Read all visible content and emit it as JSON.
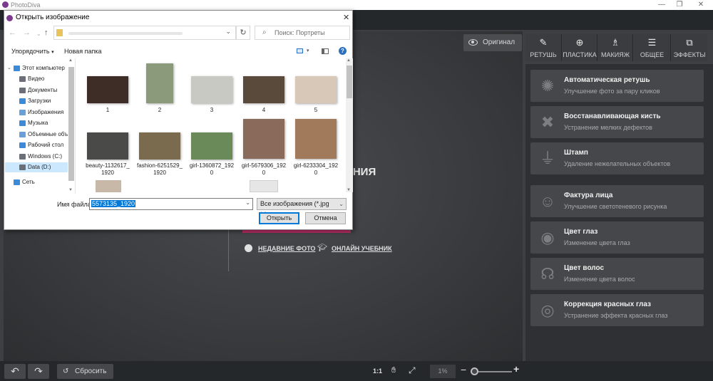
{
  "app": {
    "title": "PhotoDiva",
    "controls": {
      "minimize": "—",
      "restore": "❐",
      "close": "✕"
    }
  },
  "original_button": "Оригинал",
  "toolbar": {
    "tabs": [
      {
        "label": "РЕТУШЬ",
        "icon": "brush-icon"
      },
      {
        "label": "ПЛАСТИКА",
        "icon": "liquify-icon"
      },
      {
        "label": "МАКИЯЖ",
        "icon": "makeup-icon"
      },
      {
        "label": "ОБЩЕЕ",
        "icon": "sliders-icon"
      },
      {
        "label": "ЭФФЕКТЫ",
        "icon": "effects-icon"
      }
    ]
  },
  "tools": [
    {
      "title": "Автоматическая ретушь",
      "subtitle": "Улучшение фото за пару кликов",
      "icon": "auto-retouch-icon"
    },
    {
      "title": "Восстанавливающая кисть",
      "subtitle": "Устранение мелких дефектов",
      "icon": "healing-brush-icon"
    },
    {
      "title": "Штамп",
      "subtitle": "Удаление нежелательных объектов",
      "icon": "stamp-icon"
    },
    {
      "title": "Фактура лица",
      "subtitle": "Улучшение светотеневого рисунка",
      "icon": "face-texture-icon"
    },
    {
      "title": "Цвет глаз",
      "subtitle": "Изменение цвета глаз",
      "icon": "eye-color-icon"
    },
    {
      "title": "Цвет волос",
      "subtitle": "Изменение цвета волос",
      "icon": "hair-color-icon"
    },
    {
      "title": "Коррекция красных глаз",
      "subtitle": "Устранение эффекта красных глаз",
      "icon": "red-eye-icon"
    }
  ],
  "center": {
    "heading_fragment": "АНИЯ",
    "recent_link": "НЕДАВНИЕ ФОТО",
    "tutorial_link": "ОНЛАЙН УЧЕБНИК"
  },
  "bottom": {
    "undo": "↶",
    "redo": "↷",
    "reset_label": "Сбросить",
    "ratio": "1:1",
    "zoom_value": "1%",
    "zoom_level": 0.05
  },
  "dialog": {
    "title": "Открыть изображение",
    "close": "✕",
    "search_placeholder": "Поиск: Портреты",
    "organize": "Упорядочить",
    "new_folder": "Новая папка",
    "nav_items": [
      {
        "label": "Этот компьютер",
        "icon": "computer-icon",
        "color": "#3c8ad8"
      },
      {
        "label": "Видео",
        "icon": "video-folder-icon",
        "color": "#6b6f78"
      },
      {
        "label": "Документы",
        "icon": "documents-folder-icon",
        "color": "#6b6f78"
      },
      {
        "label": "Загрузки",
        "icon": "downloads-folder-icon",
        "color": "#3c8ad8"
      },
      {
        "label": "Изображения",
        "icon": "pictures-folder-icon",
        "color": "#6b9fd8"
      },
      {
        "label": "Музыка",
        "icon": "music-folder-icon",
        "color": "#3c8ad8"
      },
      {
        "label": "Объемные объ",
        "icon": "3d-objects-icon",
        "color": "#6b9fd8"
      },
      {
        "label": "Рабочий стол",
        "icon": "desktop-folder-icon",
        "color": "#3c8ad8"
      },
      {
        "label": "Windows (C:)",
        "icon": "drive-c-icon",
        "color": "#6b6f78"
      },
      {
        "label": "Data (D:)",
        "icon": "drive-d-icon",
        "color": "#6b6f78"
      },
      {
        "label": "Сеть",
        "icon": "network-icon",
        "color": "#3c8ad8"
      }
    ],
    "files": [
      {
        "name": "1",
        "color": "#3e2d27"
      },
      {
        "name": "2",
        "color": "#8a9a7a"
      },
      {
        "name": "3",
        "color": "#c9c9c4"
      },
      {
        "name": "4",
        "color": "#5a4a3c"
      },
      {
        "name": "5",
        "color": "#d8c8b8"
      },
      {
        "name": "beauty-1132617_\n1920",
        "color": "#4a4a48"
      },
      {
        "name": "fashion-6251529_\n1920",
        "color": "#7a6a4e"
      },
      {
        "name": "girl-1360872_192\n0",
        "color": "#6a8a5a"
      },
      {
        "name": "girl-5679306_192\n0",
        "color": "#8a6a5a"
      },
      {
        "name": "girl-6233304_192\n0",
        "color": "#a07a5a"
      }
    ],
    "filename_label": "Имя файла:",
    "filename_value": "5573135_1920",
    "filter": "Все изображения (*.jpg *.jpeg",
    "open_button": "Открыть",
    "cancel_button": "Отмена"
  }
}
